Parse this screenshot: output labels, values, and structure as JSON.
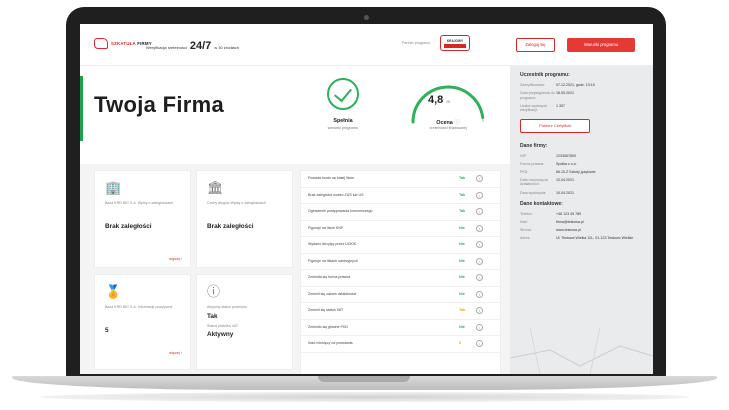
{
  "header": {
    "logo_brand": "SZKATUŁA",
    "logo_word": "FIRMY",
    "verify_prefix": "Weryfikacja rzetelności",
    "verify_big": "24/7",
    "verify_suffix": "w 30 źródłach",
    "partner_label": "Partner programu",
    "partner_logo": "KRAJOWY",
    "login_label": "Zaloguj się",
    "join_label": "Warunki programu"
  },
  "hero": {
    "company_name": "Twoja Firma",
    "meets_title": "Spełnia",
    "meets_sub": "warunki programu",
    "score_value": "4,8",
    "score_unit": "/5",
    "score_title": "Ocena",
    "score_sub": "rzetelności finansowej",
    "score_fraction": 0.96
  },
  "tiles": [
    {
      "icon": "building-icon",
      "glyph": "🏢",
      "label": "Baza KRD BIG S.A. Wpisy o zaległościach",
      "value": "Brak zaległości",
      "more": "więcej ›"
    },
    {
      "icon": "office-icon",
      "glyph": "🏛",
      "label": "Cechy długów Wpisy o zaległościach",
      "value": "Brak zaległości",
      "more": ""
    },
    {
      "icon": "badge-icon",
      "glyph": "🏅",
      "label": "Baza KRD BIG S.A. Informacje pozytywne",
      "value": "5",
      "more": "więcej ›"
    },
    {
      "icon": "info-icon",
      "glyph": "ⓘ",
      "label": "Aktywny status podmiotu",
      "value": "Tak",
      "label2": "Status płatnika VAT",
      "value2": "Aktywny",
      "more": ""
    }
  ],
  "checklist": [
    {
      "label": "Posiada konto na białej liście",
      "status": "Tak",
      "color": "#2fb05a"
    },
    {
      "label": "Brak zaległości wobec ZUS lub US",
      "status": "Tak",
      "color": "#2fb05a"
    },
    {
      "label": "Ogłoszenie postępowania komorniczego",
      "status": "Tak",
      "color": "#2fb05a"
    },
    {
      "label": "Figuruje na liście KNF",
      "status": "Nie",
      "color": "#2fb05a"
    },
    {
      "label": "Wydano decyzję przez UOKiK",
      "status": "Nie",
      "color": "#2fb05a"
    },
    {
      "label": "Figuruje na listach sankcyjnych",
      "status": "Nie",
      "color": "#2fb05a"
    },
    {
      "label": "Zmieniła się forma prawna",
      "status": "Nie",
      "color": "#2fb05a"
    },
    {
      "label": "Zmienił się zakres działalności",
      "status": "Nie",
      "color": "#2fb05a"
    },
    {
      "label": "Zmienił się status VAT",
      "status": "Tak",
      "color": "#f0a020"
    },
    {
      "label": "Zmieniło się główne PKD",
      "status": "Nie",
      "color": "#2fb05a"
    },
    {
      "label": "Ilość miesięcy od powstania",
      "status": "3",
      "color": "#f0a020"
    }
  ],
  "sidebar": {
    "participant_title": "Uczestnik programu:",
    "participant": [
      {
        "k": "Zweryfikowano:",
        "v": "07.12.2021, godz. 13:15"
      },
      {
        "k": "Data przystąpienia do programu:",
        "v": "18.05.2021"
      },
      {
        "k": "Liczba wydanych weryfikacji:",
        "v": "1 357"
      }
    ],
    "cert_button": "Pobierz Certyfikat",
    "company_title": "Dane firmy:",
    "company": [
      {
        "k": "NIP:",
        "v": "1234567890"
      },
      {
        "k": "Forma prawna:",
        "v": "Spółka z o.o."
      },
      {
        "k": "PKD:",
        "v": "86.10.Z Szkoły językowe"
      },
      {
        "k": "Data rozpoczęcia działalności:",
        "v": "10.04.2021"
      },
      {
        "k": "Data wydobycia:",
        "v": "10.04.2021"
      }
    ],
    "contact_title": "Dane kontaktowe:",
    "contact": [
      {
        "k": "Telefon:",
        "v": "+48 123 45 789"
      },
      {
        "k": "Mail:",
        "v": "firma@testowa.pl"
      },
      {
        "k": "Strona:",
        "v": "www.testowa.pl"
      },
      {
        "k": "Adres:",
        "v": "Ul. Testowa Wielka 12L, 01-123 Testowo Wielkie"
      }
    ]
  }
}
